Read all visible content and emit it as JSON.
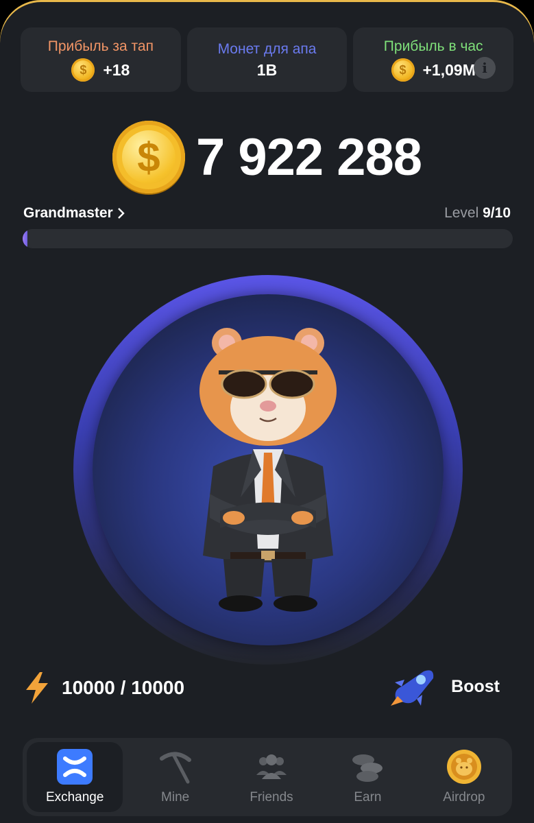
{
  "stats": [
    {
      "label": "Прибыль за тап",
      "value": "+18",
      "color": "#f29566",
      "coin": true,
      "info": false
    },
    {
      "label": "Монет для апа",
      "value": "1B",
      "color": "#6b7bf0",
      "coin": false,
      "info": false
    },
    {
      "label": "Прибыль в час",
      "value": "+1,09M",
      "color": "#7fe07a",
      "coin": true,
      "info": true
    }
  ],
  "balance": "7 922 288",
  "rank": "Grandmaster",
  "level": {
    "prefix": "Level",
    "value": "9/10",
    "progress": 0.008
  },
  "energy": "10000 / 10000",
  "boost_label": "Boost",
  "nav": [
    {
      "label": "Exchange",
      "icon": "exchange-icon",
      "active": true
    },
    {
      "label": "Mine",
      "icon": "pickaxe-icon",
      "active": false
    },
    {
      "label": "Friends",
      "icon": "friends-icon",
      "active": false
    },
    {
      "label": "Earn",
      "icon": "coins-icon",
      "active": false
    },
    {
      "label": "Airdrop",
      "icon": "hamster-coin-icon",
      "active": false
    }
  ],
  "colors": {
    "accent": "#e8b84a",
    "panel": "#272a2f",
    "progress": "#8d6ff0"
  }
}
